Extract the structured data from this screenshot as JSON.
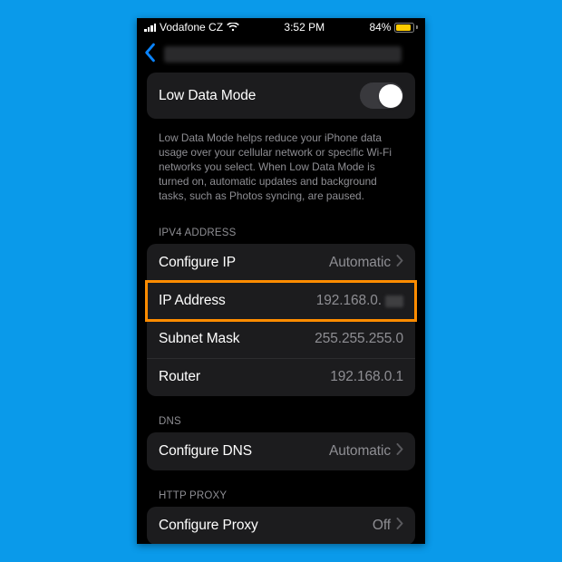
{
  "status": {
    "carrier": "Vodafone CZ",
    "time": "3:52 PM",
    "battery_pct": "84%"
  },
  "lowdata": {
    "label": "Low Data Mode",
    "desc": "Low Data Mode helps reduce your iPhone data usage over your cellular network or specific Wi-Fi networks you select. When Low Data Mode is turned on, automatic updates and background tasks, such as Photos syncing, are paused."
  },
  "sections": {
    "ipv4": {
      "header": "IPV4 ADDRESS",
      "configure_label": "Configure IP",
      "configure_value": "Automatic",
      "ip_label": "IP Address",
      "ip_value_prefix": "192.168.0.",
      "subnet_label": "Subnet Mask",
      "subnet_value": "255.255.255.0",
      "router_label": "Router",
      "router_value": "192.168.0.1"
    },
    "dns": {
      "header": "DNS",
      "configure_label": "Configure DNS",
      "configure_value": "Automatic"
    },
    "proxy": {
      "header": "HTTP PROXY",
      "configure_label": "Configure Proxy",
      "configure_value": "Off"
    }
  }
}
